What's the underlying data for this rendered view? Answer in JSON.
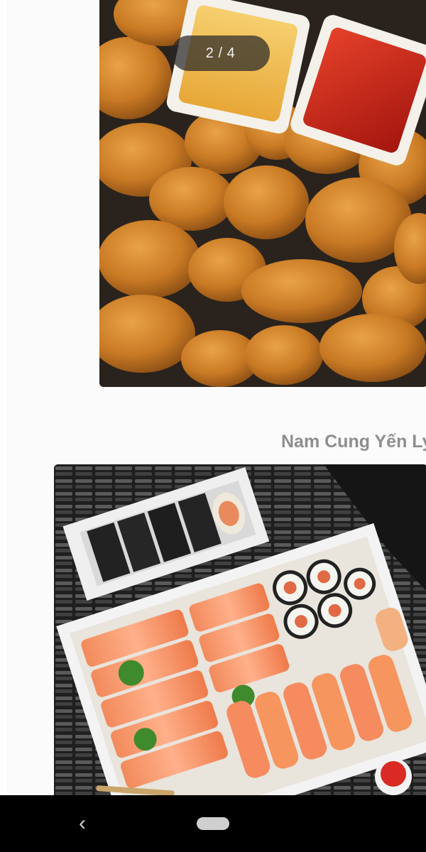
{
  "gallery": {
    "counter": "2 / 4",
    "photos": [
      {
        "subject": "fried chicken nuggets with cheese and ketchup dipping sauces"
      },
      {
        "subject": "salmon sashimi, sushi rolls and nigiri in a takeaway box"
      }
    ]
  },
  "caption": {
    "author": "Nam Cung Yến Ly"
  },
  "navigation_bar": {
    "back_icon": "chevron-left-icon",
    "home_icon": "home-pill-icon"
  },
  "colors": {
    "background": "#fbfbfb",
    "counter_background": "#282828",
    "caption_text": "#8e8e8e",
    "navbar": "#000000"
  }
}
